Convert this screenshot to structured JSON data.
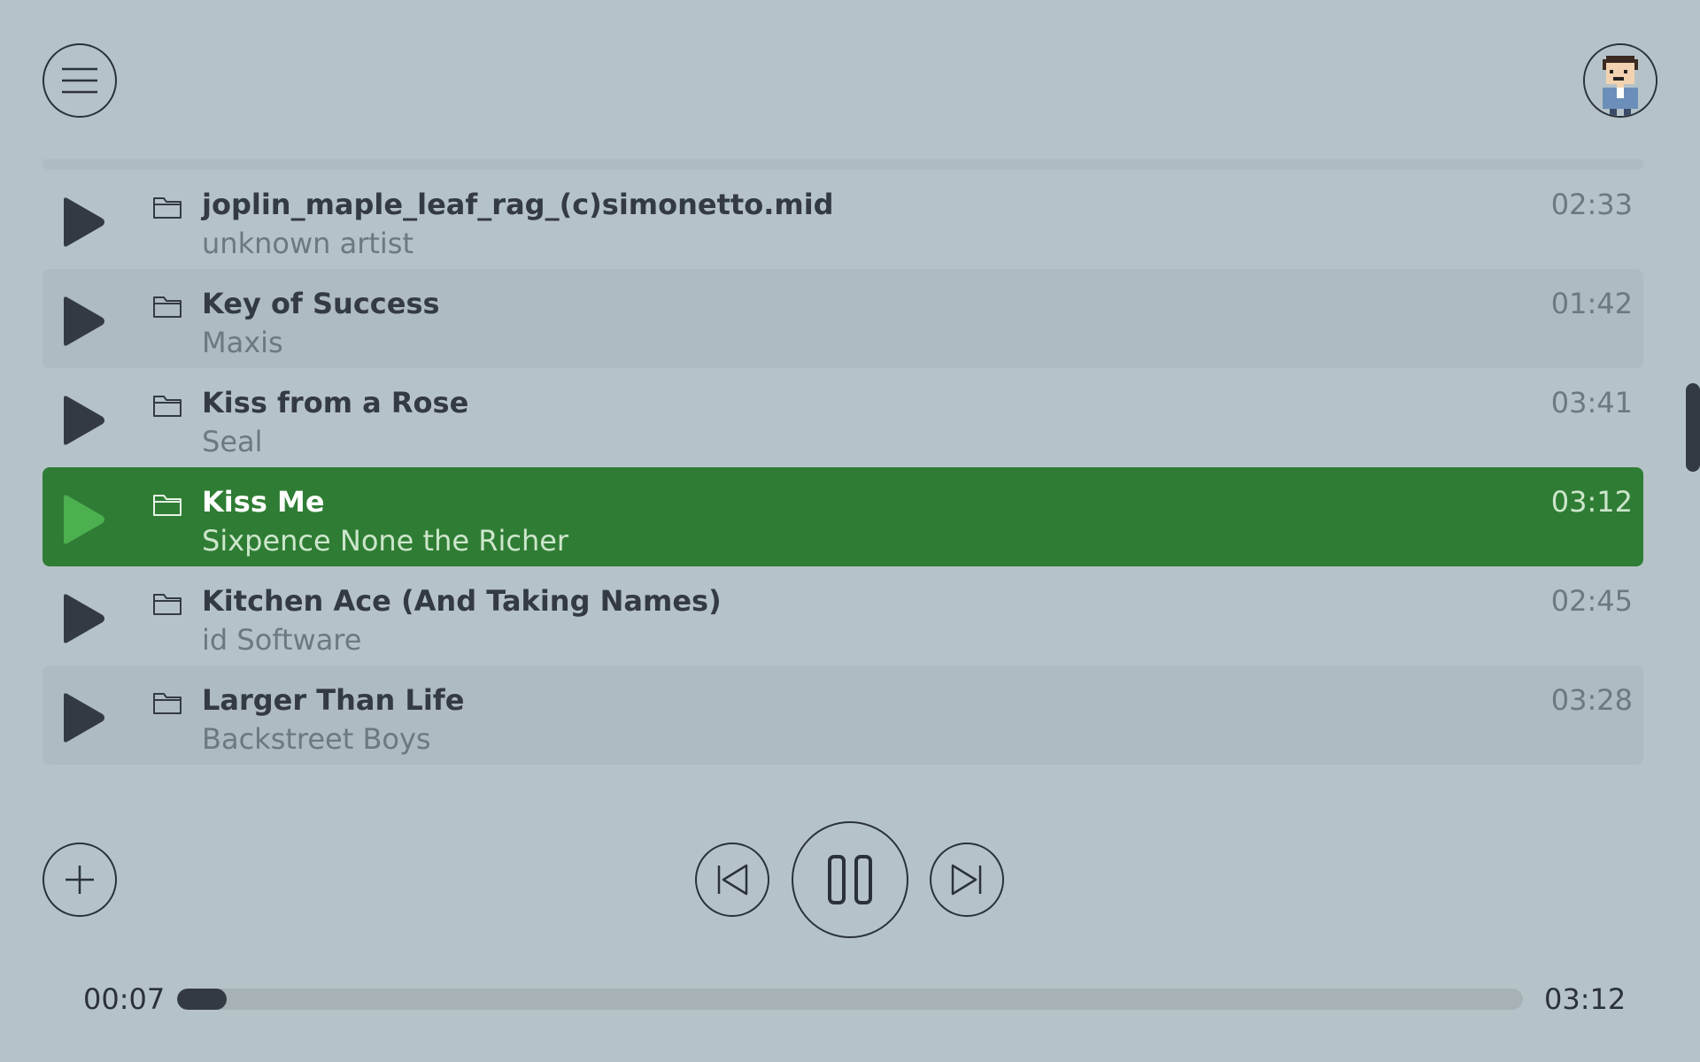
{
  "header": {
    "menu_icon": "hamburger-menu-icon",
    "avatar_icon": "pixel-avatar-icon"
  },
  "tracks": [
    {
      "title": "",
      "artist": "unknown artist",
      "duration": "",
      "state": "alt"
    },
    {
      "title": "joplin_maple_leaf_rag_(c)simonetto.mid",
      "artist": "unknown artist",
      "duration": "02:33",
      "state": "normal"
    },
    {
      "title": "Key of Success",
      "artist": "Maxis",
      "duration": "01:42",
      "state": "alt"
    },
    {
      "title": "Kiss from a Rose",
      "artist": "Seal",
      "duration": "03:41",
      "state": "normal"
    },
    {
      "title": "Kiss Me",
      "artist": "Sixpence None the Richer",
      "duration": "03:12",
      "state": "active"
    },
    {
      "title": "Kitchen Ace (And Taking Names)",
      "artist": "id Software",
      "duration": "02:45",
      "state": "normal"
    },
    {
      "title": "Larger Than Life",
      "artist": "Backstreet Boys",
      "duration": "03:28",
      "state": "alt"
    }
  ],
  "player": {
    "elapsed": "00:07",
    "total": "03:12",
    "progress_fraction": 0.037,
    "controls": {
      "add_icon": "plus-icon",
      "prev_icon": "skip-previous-icon",
      "pause_icon": "pause-icon",
      "next_icon": "skip-next-icon"
    }
  },
  "colors": {
    "background": "#b5c3c8",
    "row_alt": "#aebbc0",
    "row_active": "#2f7d34",
    "play_active": "#4caf50",
    "play_default": "#343a44"
  },
  "scroll": {
    "position_fraction": 0.42
  }
}
